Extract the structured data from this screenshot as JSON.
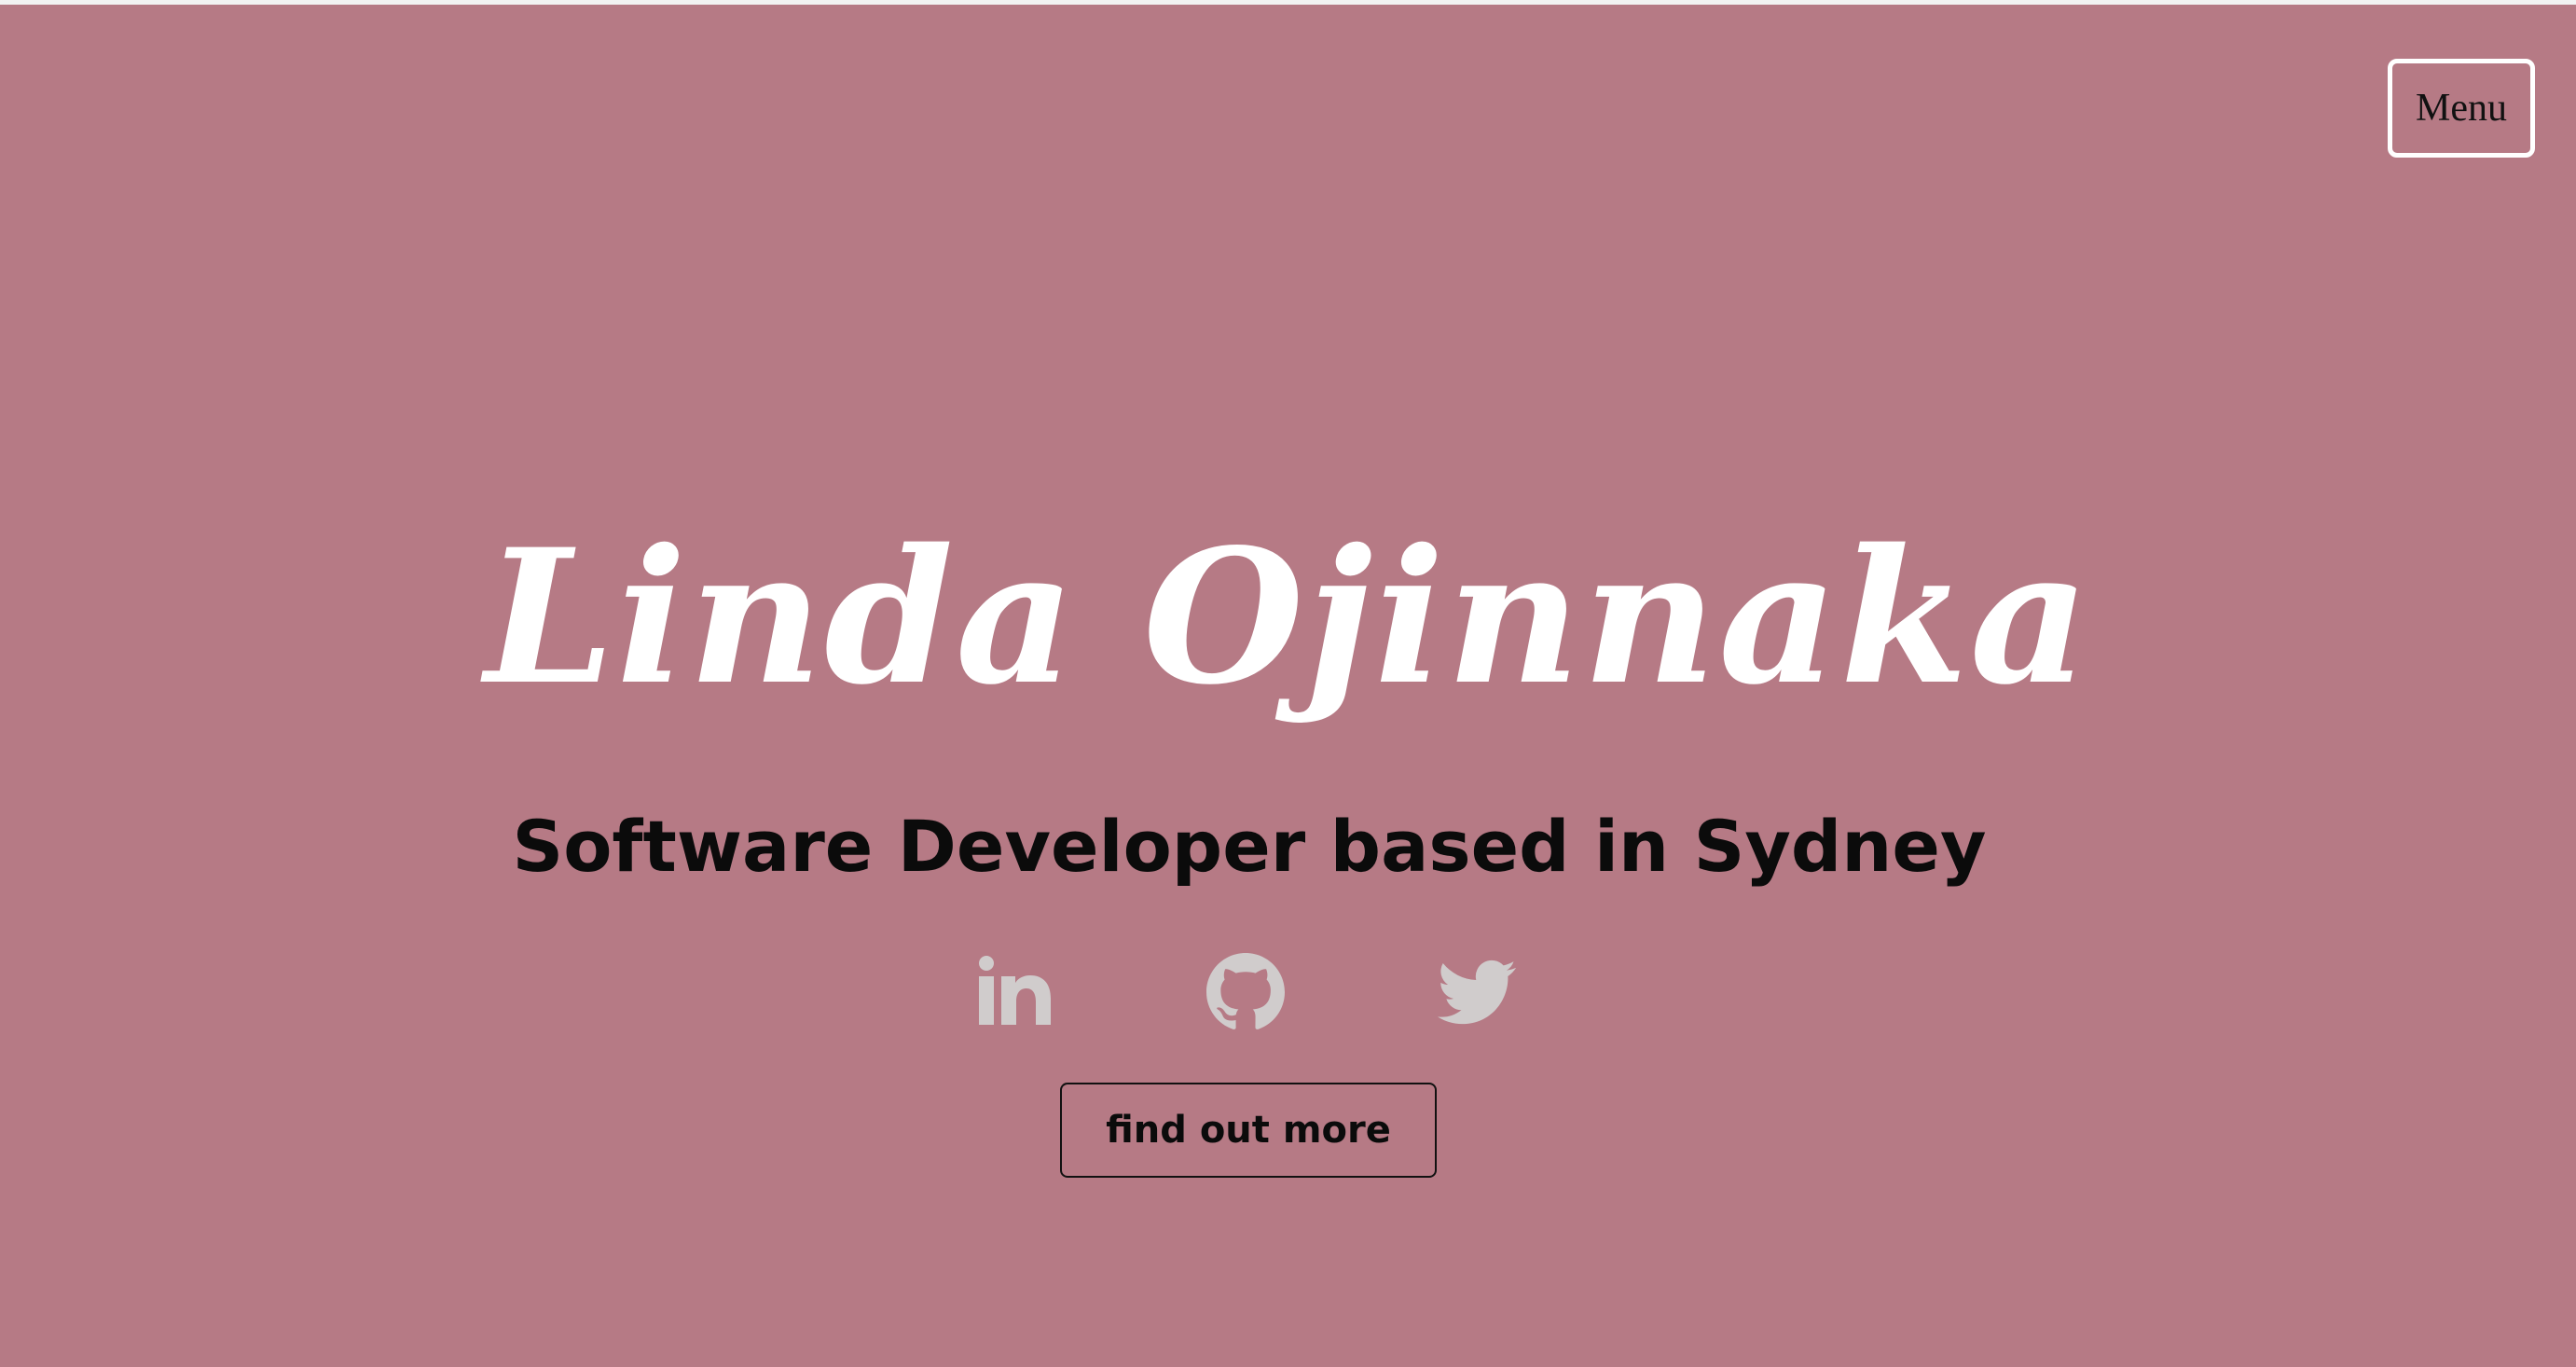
{
  "header": {
    "menu_label": "Menu"
  },
  "hero": {
    "name": "Linda Ojinnaka",
    "tagline": "Software Developer based in Sydney",
    "cta_label": "find out more"
  },
  "social": [
    {
      "icon": "linkedin-icon"
    },
    {
      "icon": "github-icon"
    },
    {
      "icon": "twitter-icon"
    }
  ],
  "colors": {
    "background": "#b67a85",
    "name_text": "#ffffff",
    "tagline_text": "#0b0b0b",
    "social_icon": "#d0cccc",
    "menu_border": "#ffffff"
  }
}
